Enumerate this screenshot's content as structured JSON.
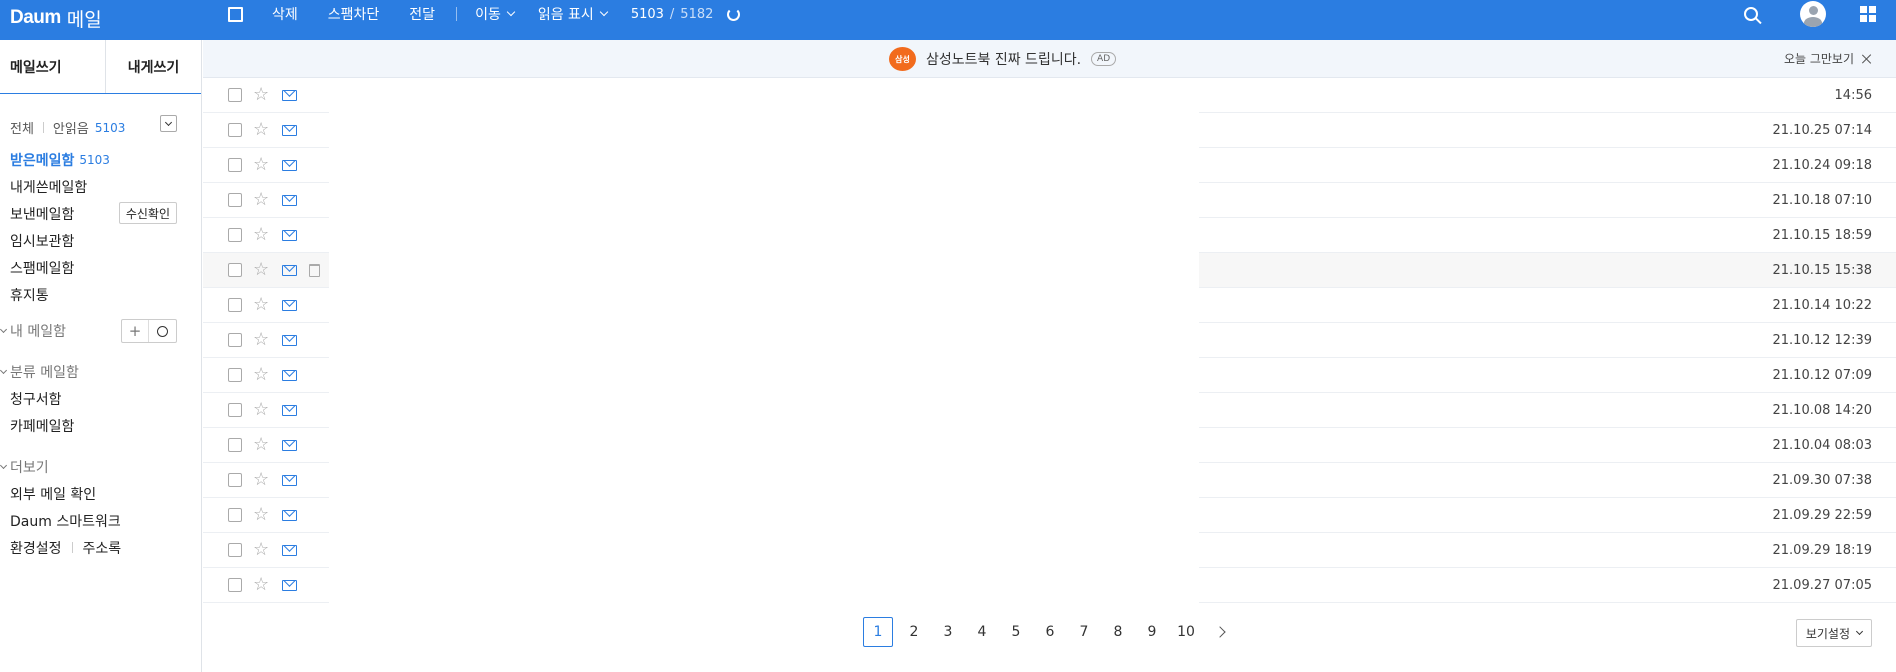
{
  "header": {
    "logo_brand": "Daum",
    "logo_service": "메일",
    "toolbar": {
      "delete": "삭제",
      "spam_block": "스팸차단",
      "forward": "전달",
      "move": "이동",
      "mark_read": "읽음 표시",
      "count_unread": "5103",
      "count_sep": "/",
      "count_total": "5182"
    },
    "icons": [
      "select-all-checkbox-icon",
      "refresh-icon",
      "search-icon",
      "account-icon",
      "apps-grid-icon"
    ]
  },
  "sidebar": {
    "compose_mail": "메일쓰기",
    "compose_self": "내게쓰기",
    "filter": {
      "all": "전체",
      "unread": "안읽음",
      "unread_count": "5103"
    },
    "folders": [
      {
        "label": "받은메일함",
        "count": "5103"
      },
      {
        "label": "내게쓴메일함"
      },
      {
        "label": "보낸메일함",
        "action": "수신확인"
      },
      {
        "label": "임시보관함"
      },
      {
        "label": "스팸메일함"
      },
      {
        "label": "휴지통"
      }
    ],
    "my_folders": {
      "title": "내 메일함",
      "add": "+"
    },
    "category": {
      "title": "분류 메일함",
      "items": [
        "청구서함",
        "카페메일함"
      ]
    },
    "more": {
      "title": "더보기",
      "items": [
        "외부 메일 확인",
        "Daum 스마트워크"
      ],
      "settings": "환경설정",
      "address_book": "주소록"
    }
  },
  "ad": {
    "logo_text": "삼성",
    "text": "삼성노트북 진짜 드립니다.",
    "tag": "AD",
    "close_today": "오늘 그만보기"
  },
  "mail_list": {
    "dates": [
      "14:56",
      "21.10.25 07:14",
      "21.10.24 09:18",
      "21.10.18 07:10",
      "21.10.15 18:59",
      "21.10.15 15:38",
      "21.10.14 10:22",
      "21.10.12 12:39",
      "21.10.12 07:09",
      "21.10.08 14:20",
      "21.10.04 08:03",
      "21.09.30 07:38",
      "21.09.29 22:59",
      "21.09.29 18:19",
      "21.09.27 07:05"
    ]
  },
  "pagination": {
    "pages": [
      "1",
      "2",
      "3",
      "4",
      "5",
      "6",
      "7",
      "8",
      "9",
      "10"
    ],
    "current": "1"
  },
  "view_settings": "보기설정",
  "colors": {
    "brand": "#2b7de1",
    "ad_bar": "#f2f6fb"
  }
}
